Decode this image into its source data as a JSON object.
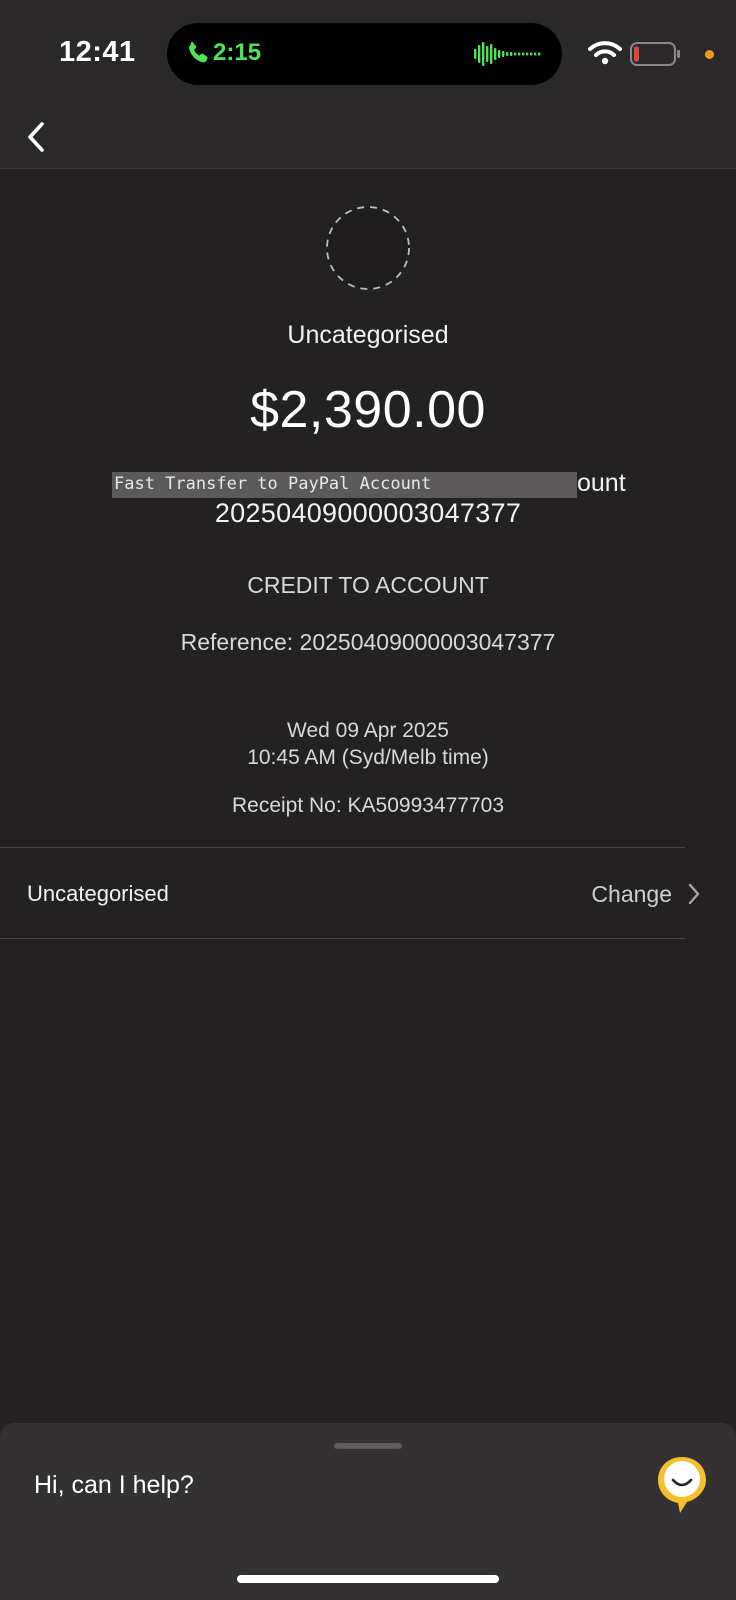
{
  "status_bar": {
    "time": "12:41",
    "call_timer": "2:15",
    "icons": [
      "phone-icon",
      "waveform-icon",
      "wifi-icon",
      "battery-icon",
      "mic-indicator-dot"
    ],
    "colors": {
      "call_green": "#4fe35b",
      "battery_low": "#e0443e",
      "mic_dot": "#f19a1f"
    }
  },
  "nav": {
    "back_icon": "chevron-left-icon"
  },
  "transaction": {
    "category_icon": "dashed-circle-icon",
    "category": "Uncategorised",
    "amount": "$2,390.00",
    "description": "Fast Transfer to PayPal Account",
    "description_tail": "ount",
    "transaction_id": "20250409000003047377",
    "type": "CREDIT TO ACCOUNT",
    "reference": "Reference: 20250409000003047377",
    "date": "Wed 09 Apr 2025",
    "time": "10:45 AM (Syd/Melb time)",
    "receipt": "Receipt No: KA50993477703"
  },
  "category_row": {
    "label": "Uncategorised",
    "action": "Change",
    "chevron_icon": "chevron-right-icon"
  },
  "help_sheet": {
    "prompt": "Hi, can I help?",
    "assistant_icon": "chat-assistant-icon",
    "accent_color": "#f5c02c"
  }
}
